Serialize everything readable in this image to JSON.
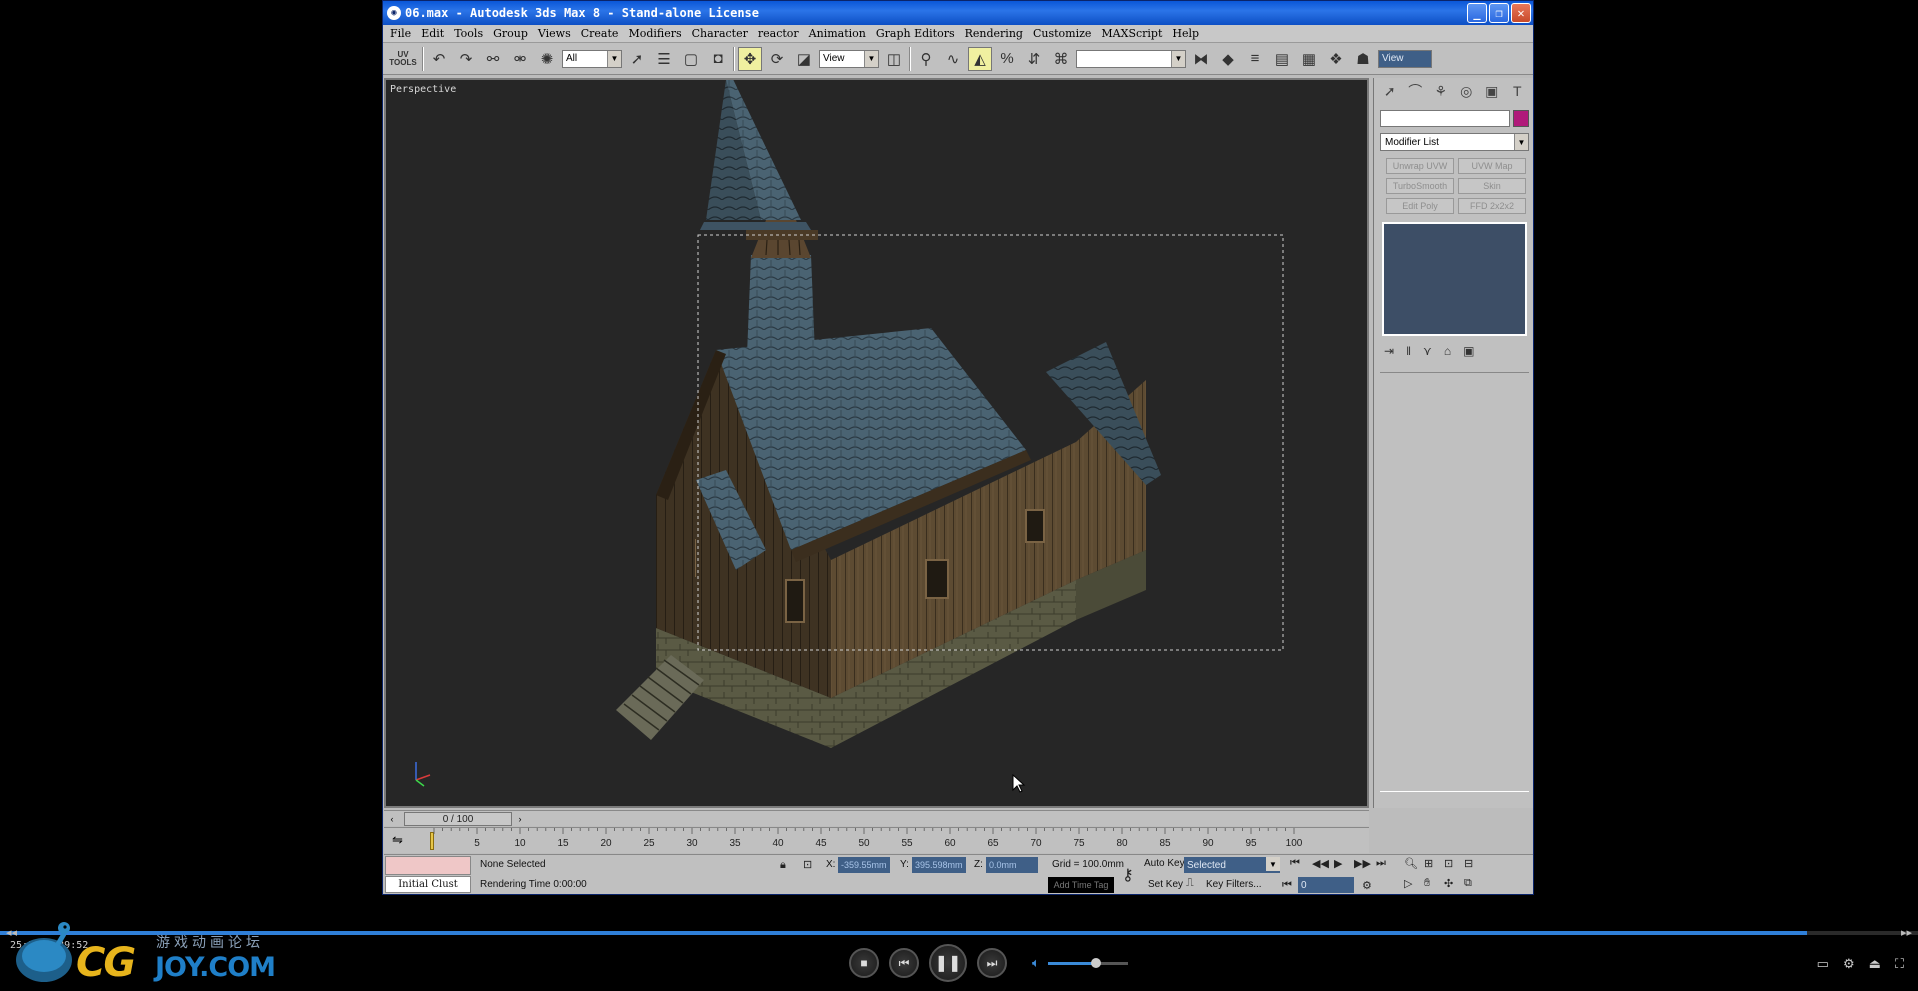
{
  "window": {
    "title": "06.max  -  Autodesk 3ds Max 8   - Stand-alone License",
    "minimize": "_",
    "restore": "❐",
    "close": "✕"
  },
  "menu": [
    "File",
    "Edit",
    "Tools",
    "Group",
    "Views",
    "Create",
    "Modifiers",
    "Character",
    "reactor",
    "Animation",
    "Graph Editors",
    "Rendering",
    "Customize",
    "MAXScript",
    "Help"
  ],
  "toolbar": {
    "uv_tools_label": "UV TOOLS",
    "selection_filter": "All",
    "ref_coord": "View",
    "named_selection": "",
    "view_right": "View"
  },
  "viewport": {
    "label": "Perspective"
  },
  "command_panel": {
    "modifier_list": "Modifier List",
    "modifier_buttons": [
      "Unwrap UVW",
      "UVW Map",
      "TurboSmooth",
      "Skin",
      "Edit Poly",
      "FFD 2x2x2"
    ]
  },
  "time_slider": {
    "position": "0 / 100",
    "ticks": [
      "5",
      "10",
      "15",
      "20",
      "25",
      "30",
      "35",
      "40",
      "45",
      "50",
      "55",
      "60",
      "65",
      "70",
      "75",
      "80",
      "85",
      "90",
      "95",
      "100"
    ]
  },
  "status": {
    "cluster_label": "Initial Clust",
    "selection": "None Selected",
    "rendering_time": "Rendering Time  0:00:00",
    "x_label": "X:",
    "x_value": "-359.55mm",
    "y_label": "Y:",
    "y_value": "395.598mm",
    "z_label": "Z:",
    "z_value": "0.0mm",
    "grid": "Grid = 100.0mm",
    "add_time_tag": "Add Time Tag",
    "auto_key": "Auto Key",
    "set_key": "Set Key",
    "key_mode": "Selected",
    "key_filters": "Key Filters...",
    "frame": "0"
  },
  "player": {
    "timecode": "25:59 / 29:52",
    "progress": 0.942,
    "volume": 0.6,
    "logo_cg": "CG",
    "logo_chinese": "游戏动画论坛",
    "logo_domain": "JOY.COM"
  },
  "colors": {
    "viewport_bg": "#262626",
    "titlebar": "#0a57d8",
    "object_color": "#b01a7a",
    "progress_fill": "#2f7fd8"
  }
}
